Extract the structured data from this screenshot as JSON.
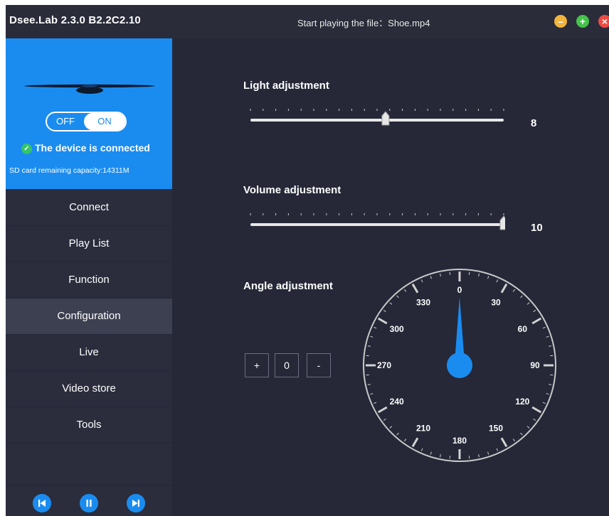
{
  "titlebar": {
    "app_title": "Dsee.Lab 2.3.0 B2.2C2.10",
    "status": "Start playing the file：Shoe.mp4",
    "minimize_glyph": "–",
    "maximize_glyph": "+",
    "close_glyph": "×"
  },
  "device": {
    "toggle_off": "OFF",
    "toggle_on": "ON",
    "toggle_state": "ON",
    "status": "The device is connected",
    "check_glyph": "✓",
    "capacity": "SD card remaining capacity:14311M"
  },
  "nav": {
    "items": [
      {
        "label": "Connect"
      },
      {
        "label": "Play List"
      },
      {
        "label": "Function"
      },
      {
        "label": "Configuration"
      },
      {
        "label": "Live"
      },
      {
        "label": "Video store"
      },
      {
        "label": "Tools"
      }
    ],
    "active": "Configuration"
  },
  "media": {
    "prev_icon": "skip-previous-icon",
    "pause_icon": "pause-icon",
    "next_icon": "skip-next-icon"
  },
  "light": {
    "label": "Light adjustment",
    "value": "8",
    "min": 0,
    "max": 15,
    "level": 8
  },
  "volume": {
    "label": "Volume adjustment",
    "value": "10",
    "min": 0,
    "max": 10,
    "level": 10
  },
  "angle": {
    "label": "Angle adjustment",
    "plus": "+",
    "value": "0",
    "minus": "-",
    "degrees": 0,
    "dial_labels": [
      "0",
      "30",
      "60",
      "90",
      "120",
      "150",
      "180",
      "210",
      "240",
      "270",
      "300",
      "330"
    ]
  },
  "colors": {
    "accent": "#1a8cf0",
    "background": "#262838",
    "sidebar": "#2b2d3d",
    "active_nav": "#3d4050",
    "connected_check": "#35c46a"
  }
}
